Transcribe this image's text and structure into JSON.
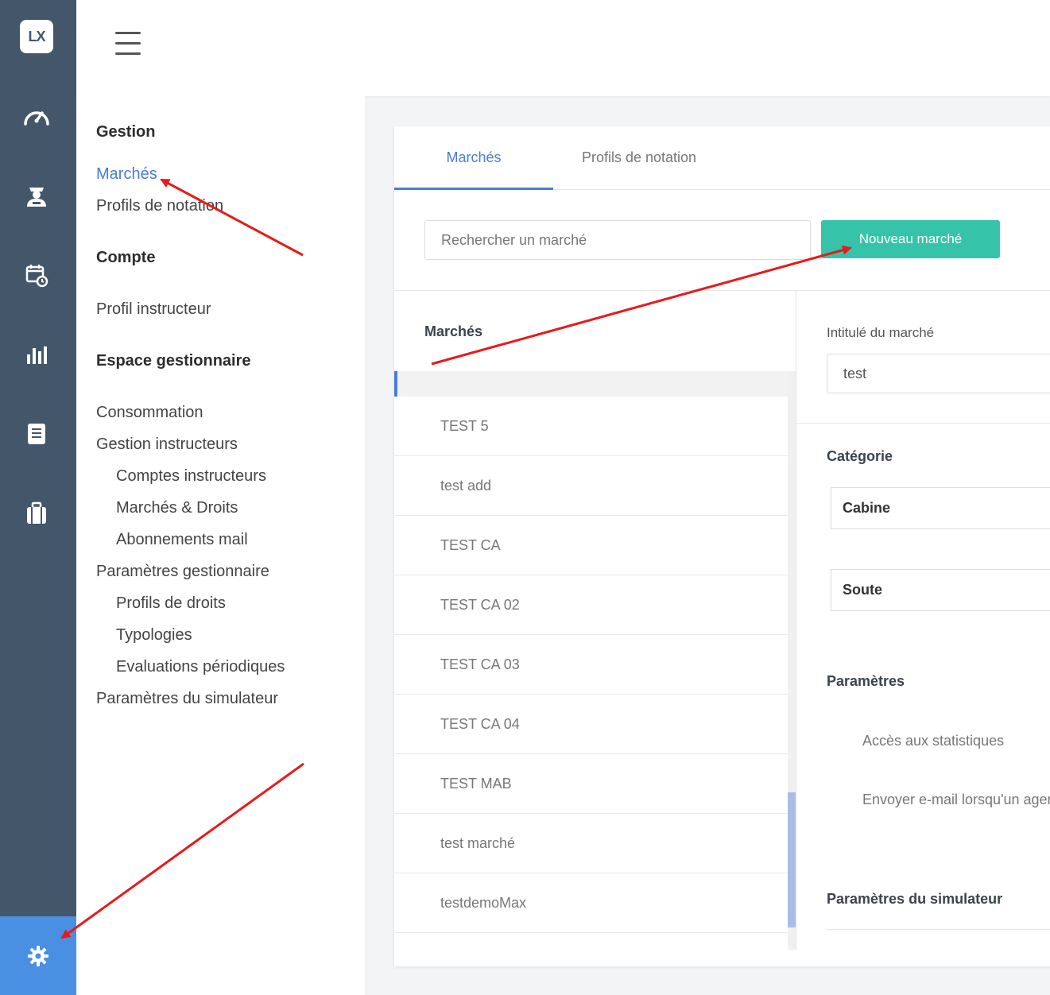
{
  "app": {
    "logo_text": "LX"
  },
  "rail": {
    "icons": [
      "speedometer-icon",
      "pilot-icon",
      "calendar-clock-icon",
      "bar-chart-icon",
      "document-icon",
      "briefcase-icon",
      "gear-icon"
    ]
  },
  "subnav": {
    "sections": [
      {
        "title": "Gestion"
      },
      {
        "title": "Compte"
      },
      {
        "title": "Espace gestionnaire"
      }
    ],
    "links": {
      "marches": "Marchés",
      "profils_notation": "Profils de notation",
      "profil_instructeur": "Profil instructeur",
      "consommation": "Consommation",
      "gestion_instructeurs": "Gestion instructeurs",
      "comptes_instructeurs": "Comptes instructeurs",
      "marches_droits": "Marchés & Droits",
      "abonnements_mail": "Abonnements mail",
      "parametres_gestionnaire": "Paramètres gestionnaire",
      "profils_droits": "Profils de droits",
      "typologies": "Typologies",
      "evaluations": "Evaluations périodiques",
      "parametres_simulateur": "Paramètres du simulateur"
    }
  },
  "tabs": [
    "Marchés",
    "Profils de notation"
  ],
  "toolbar": {
    "search_placeholder": "Rechercher un marché",
    "new_button": "Nouveau marché"
  },
  "list": {
    "heading": "Marchés",
    "rows": [
      "TEST 5",
      "test add",
      "TEST CA",
      "TEST CA 02",
      "TEST CA 03",
      "TEST CA 04",
      "TEST MAB",
      "test marché",
      "testdemoMax"
    ]
  },
  "detail": {
    "name_label": "Intitulé du marché",
    "name_value": "test",
    "category_heading": "Catégorie",
    "categories": [
      "Cabine",
      "Soute"
    ],
    "params_heading": "Paramètres",
    "params": [
      "Accès aux statistiques",
      "Envoyer e-mail lorsqu'un agent"
    ],
    "sim_heading": "Paramètres du simulateur"
  },
  "colors": {
    "rail": "#44576a",
    "accent": "#4a7cd6",
    "button": "#35c4aa",
    "annotation": "#e81a1a"
  }
}
